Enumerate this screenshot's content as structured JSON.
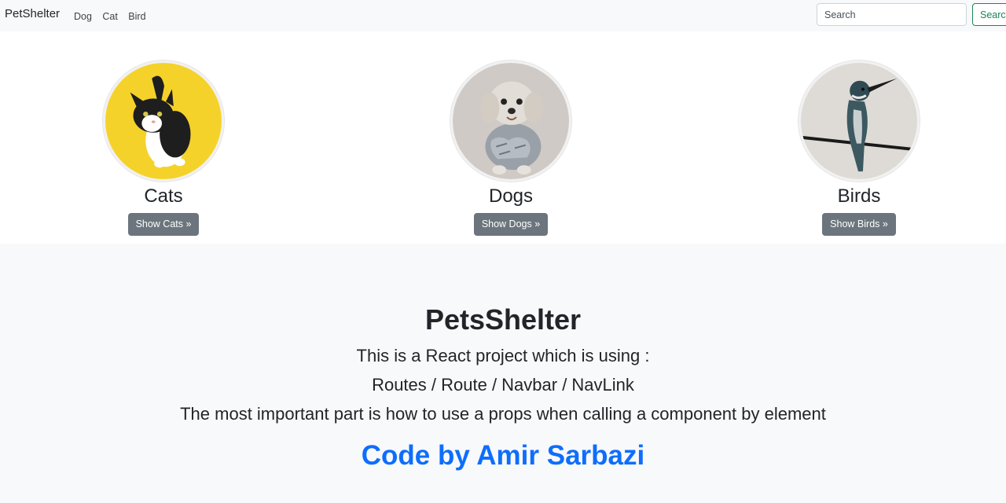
{
  "navbar": {
    "brand": "PetShelter",
    "links": [
      "Dog",
      "Cat",
      "Bird"
    ],
    "search_placeholder": "Search",
    "search_button": "Search"
  },
  "animals": [
    {
      "title": "Cats",
      "button": "Show Cats »"
    },
    {
      "title": "Dogs",
      "button": "Show Dogs »"
    },
    {
      "title": "Birds",
      "button": "Show Birds »"
    }
  ],
  "about": {
    "title": "PetsShelter",
    "lines": [
      "This is a React project which is using :",
      "Routes / Route / Navbar / NavLink",
      "The most important part is how to use a props when calling a component by element"
    ],
    "credit": "Code by Amir Sarbazi"
  },
  "colors": {
    "navbar_bg": "#f8f9fa",
    "secondary_button": "#6c757d",
    "success_outline": "#198754",
    "credit_blue": "#0d6efd"
  }
}
